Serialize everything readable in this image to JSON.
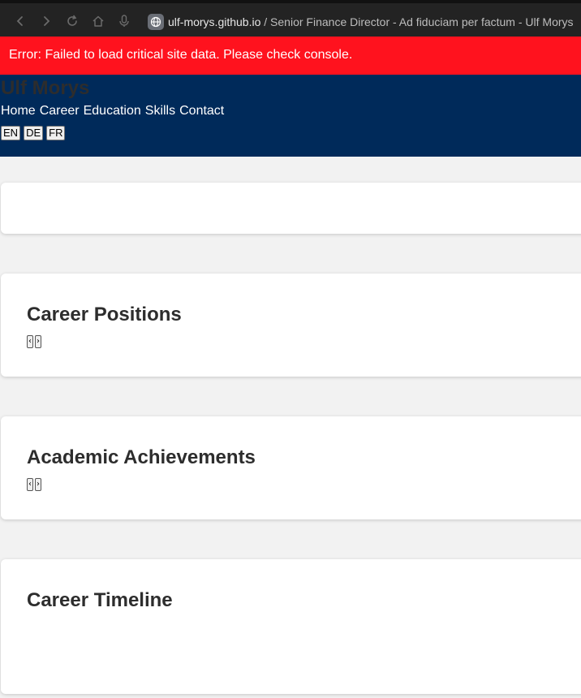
{
  "browser": {
    "host": "ulf-morys.github.io",
    "title_suffix": " / Senior Finance Director - Ad fiduciam per factum - Ulf Morys",
    "icons": [
      "back-icon",
      "forward-icon",
      "reload-icon",
      "home-icon",
      "microphone-icon",
      "globe-icon"
    ]
  },
  "error": {
    "message": "Error: Failed to load critical site data. Please check console."
  },
  "header": {
    "name": "Ulf Morys",
    "nav": [
      "Home",
      "Career",
      "Education",
      "Skills",
      "Contact"
    ],
    "languages": [
      "EN",
      "DE",
      "FR"
    ]
  },
  "sections": {
    "career": {
      "title": "Career Positions",
      "prev": "‹",
      "next": "›"
    },
    "academic": {
      "title": "Academic Achievements",
      "prev": "‹",
      "next": "›"
    },
    "timeline": {
      "title": "Career Timeline"
    }
  },
  "colors": {
    "error_bg": "#ff121e",
    "header_bg": "#002a5a",
    "page_bg": "#f2f2f2",
    "card_bg": "#ffffff",
    "heading_text": "#2d2d2d"
  }
}
